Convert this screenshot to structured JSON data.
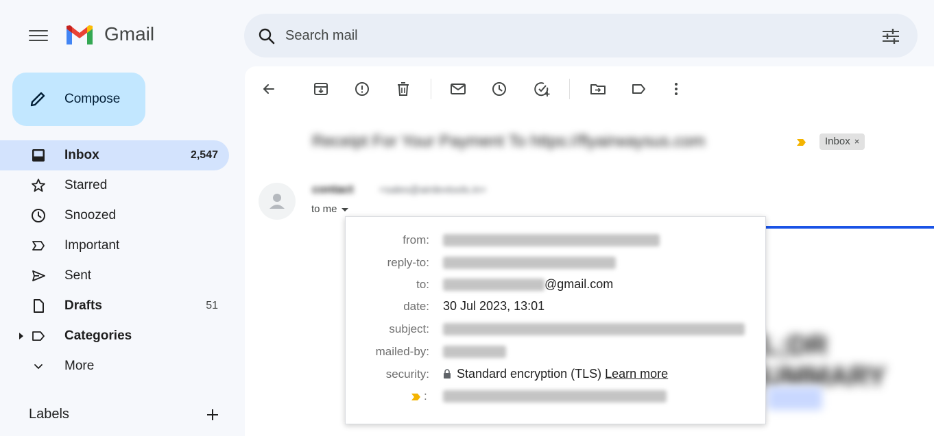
{
  "app": {
    "name": "Gmail"
  },
  "search": {
    "placeholder": "Search mail"
  },
  "compose": {
    "label": "Compose"
  },
  "sidebar": {
    "items": [
      {
        "label": "Inbox",
        "count": "2,547",
        "icon": "inbox-icon"
      },
      {
        "label": "Starred",
        "count": "",
        "icon": "star-icon"
      },
      {
        "label": "Snoozed",
        "count": "",
        "icon": "clock-icon"
      },
      {
        "label": "Important",
        "count": "",
        "icon": "important-icon"
      },
      {
        "label": "Sent",
        "count": "",
        "icon": "send-icon"
      },
      {
        "label": "Drafts",
        "count": "51",
        "icon": "draft-icon"
      },
      {
        "label": "Categories",
        "count": "",
        "icon": "label-icon"
      },
      {
        "label": "More",
        "count": "",
        "icon": "chevron-down-icon"
      }
    ],
    "labels_title": "Labels"
  },
  "email": {
    "subject": "Receipt For Your Payment To https://flyairwaysus.com",
    "chip_label": "Inbox",
    "chip_close": "×",
    "sender_name": "contact",
    "sender_email": "<sales@airdevtools.in>",
    "to_me": "to me",
    "background_heading": "TL;DR SUMMARY",
    "details": {
      "from_key": "from:",
      "from_value_blurred": "contact <sales@airdevtools.in>",
      "replyto_key": "reply-to:",
      "replyto_value_blurred": "onlinesupport@airdevtools.com",
      "to_key": "to:",
      "to_value_suffix": "@gmail.com",
      "date_key": "date:",
      "date_value": "30 Jul 2023, 13:01",
      "subject_key": "subject:",
      "subject_value_blurred": "Receipt For Your Payment To https://flyairwaysus.com",
      "mailedby_key": "mailed-by:",
      "mailedby_value_blurred": "airdevtools.in",
      "security_key": "security:",
      "security_value": "Standard encryption (TLS)",
      "security_link": "Learn more",
      "importance_key": ":",
      "importance_value_blurred": "Important according to Google magic."
    }
  },
  "colors": {
    "compose_bg": "#c2e7ff",
    "active_nav_bg": "#d3e3fd",
    "search_bg": "#e9eef6",
    "importance_marker": "#f4b400"
  }
}
